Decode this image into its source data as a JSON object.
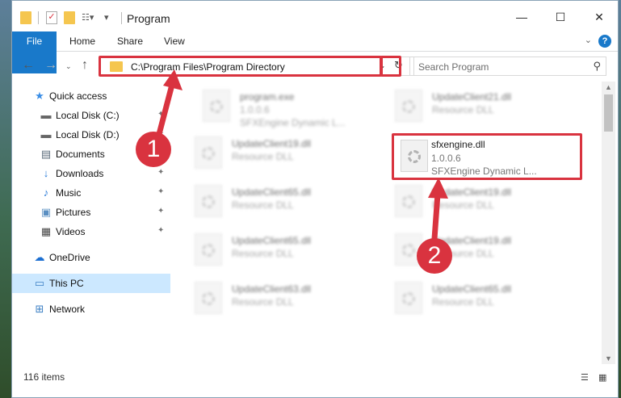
{
  "window": {
    "title": "Program",
    "controls": {
      "minimize": "—",
      "maximize": "☐",
      "close": "✕"
    }
  },
  "ribbon": {
    "tabs": [
      "File",
      "Home",
      "Share",
      "View"
    ],
    "help": "?"
  },
  "nav": {
    "address": "C:\\Program Files\\Program Directory",
    "search_placeholder": "Search Program"
  },
  "sidebar": {
    "items": [
      {
        "label": "Quick access",
        "icon": "star-icon"
      },
      {
        "label": "Local Disk (C:)",
        "icon": "drive-icon"
      },
      {
        "label": "Local Disk (D:)",
        "icon": "drive-icon"
      },
      {
        "label": "Documents",
        "icon": "documents-icon"
      },
      {
        "label": "Downloads",
        "icon": "download-icon"
      },
      {
        "label": "Music",
        "icon": "music-icon"
      },
      {
        "label": "Pictures",
        "icon": "pictures-icon"
      },
      {
        "label": "Videos",
        "icon": "videos-icon"
      },
      {
        "label": "OneDrive",
        "icon": "cloud-icon"
      },
      {
        "label": "This PC",
        "icon": "computer-icon"
      },
      {
        "label": "Network",
        "icon": "network-icon"
      }
    ]
  },
  "files": [
    {
      "name": "program.exe",
      "line2": "1.0.0.6",
      "line3": "SFXEngine Dynamic L..."
    },
    {
      "name": "UpdateClient21.dll",
      "line2": "Resource DLL"
    },
    {
      "name": "UpdateClient19.dll",
      "line2": "Resource DLL"
    },
    {
      "name": "sfxengine.dll",
      "line2": "1.0.0.6",
      "line3": "SFXEngine Dynamic L..."
    },
    {
      "name": "UpdateClient65.dll",
      "line2": "Resource DLL"
    },
    {
      "name": "UpdateClient19.dll",
      "line2": "Resource DLL"
    },
    {
      "name": "UpdateClient65.dll",
      "line2": "Resource DLL"
    },
    {
      "name": "UpdateClient19.dll",
      "line2": "Resource DLL"
    },
    {
      "name": "UpdateClient63.dll",
      "line2": "Resource DLL"
    },
    {
      "name": "UpdateClient65.dll",
      "line2": "Resource DLL"
    }
  ],
  "status": {
    "count": "116 items"
  },
  "annotations": {
    "step1": "1",
    "step2": "2"
  },
  "colors": {
    "accent": "#1979ca",
    "highlight": "#d9333f",
    "selected": "#cce8ff"
  }
}
